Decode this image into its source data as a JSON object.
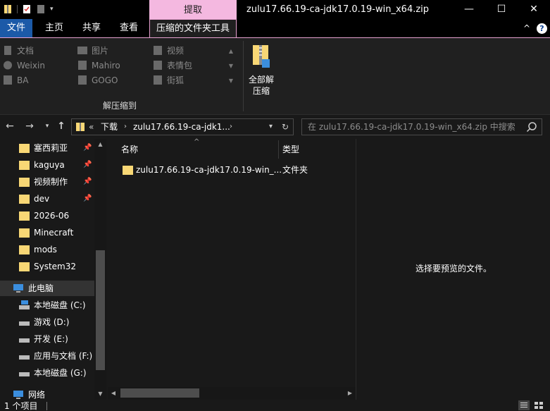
{
  "window": {
    "title": "zulu17.66.19-ca-jdk17.0.19-win_x64.zip",
    "context_tab_header": "提取",
    "minimize": "—",
    "maximize": "☐",
    "close": "✕"
  },
  "ribbon_tabs": {
    "file": "文件",
    "home": "主页",
    "share": "共享",
    "view": "查看",
    "compressed_tools": "压缩的文件夹工具",
    "collapse": "^"
  },
  "ribbon": {
    "extract_to_items": [
      "文档",
      "图片",
      "视频",
      "Weixin",
      "Mahiro",
      "表情包",
      "BA",
      "GOGO",
      "街狐"
    ],
    "extract_to_label": "解压缩到",
    "extract_all_line1": "全部解",
    "extract_all_line2": "压缩"
  },
  "address": {
    "overflow": "«",
    "crumb1": "下载",
    "crumb2": "zulu17.66.19-ca-jdk1...",
    "search_placeholder": "在 zulu17.66.19-ca-jdk17.0.19-win_x64.zip 中搜索"
  },
  "nav_pane": {
    "quick_access": [
      "塞西莉亚",
      "kaguya",
      "视频制作",
      "dev",
      "2026-06",
      "Minecraft",
      "mods",
      "System32"
    ],
    "this_pc": "此电脑",
    "drives": [
      "本地磁盘 (C:)",
      "游戏 (D:)",
      "开发 (E:)",
      "应用与文档 (F:)",
      "本地磁盘 (G:)"
    ],
    "network": "网络"
  },
  "file_list": {
    "col_name": "名称",
    "col_type": "类型",
    "rows": [
      {
        "name": "zulu17.66.19-ca-jdk17.0.19-win_...",
        "type": "文件夹"
      }
    ]
  },
  "preview": {
    "message": "选择要预览的文件。"
  },
  "status": {
    "count": "1 个项目"
  },
  "colors": {
    "accent_tab": "#1c5aa8",
    "context_header": "#f4b8e0",
    "folder": "#f8d775",
    "background": "#191919"
  }
}
